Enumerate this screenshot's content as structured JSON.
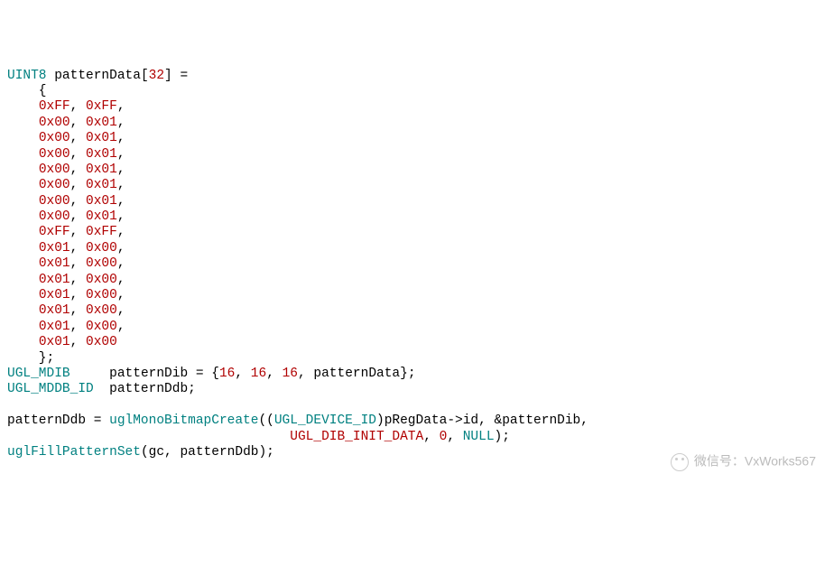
{
  "code": {
    "decl_type": "UINT8",
    "decl_name": "patternData",
    "decl_size_open": "[",
    "decl_size": "32",
    "decl_size_close": "] =",
    "brace_open": "    {",
    "rows": [
      {
        "a": "0xFF",
        "b": "0xFF"
      },
      {
        "a": "0x00",
        "b": "0x01"
      },
      {
        "a": "0x00",
        "b": "0x01"
      },
      {
        "a": "0x00",
        "b": "0x01"
      },
      {
        "a": "0x00",
        "b": "0x01"
      },
      {
        "a": "0x00",
        "b": "0x01"
      },
      {
        "a": "0x00",
        "b": "0x01"
      },
      {
        "a": "0x00",
        "b": "0x01"
      },
      {
        "a": "0xFF",
        "b": "0xFF"
      },
      {
        "a": "0x01",
        "b": "0x00"
      },
      {
        "a": "0x01",
        "b": "0x00"
      },
      {
        "a": "0x01",
        "b": "0x00"
      },
      {
        "a": "0x01",
        "b": "0x00"
      },
      {
        "a": "0x01",
        "b": "0x00"
      },
      {
        "a": "0x01",
        "b": "0x00"
      },
      {
        "a": "0x01",
        "b": "0x00"
      }
    ],
    "brace_close": "    };",
    "mdib_type": "UGL_MDIB",
    "mdib_name": "patternDib",
    "mdib_eq": " = {",
    "mdib_v1": "16",
    "mdib_v2": "16",
    "mdib_v3": "16",
    "mdib_v4": "patternData",
    "mdib_close": "};",
    "mddb_type": "UGL_MDDB_ID",
    "mddb_name": "patternDdb",
    "mddb_semi": ";",
    "assign_lhs": "patternDdb",
    "assign_eq": " = ",
    "fn_create": "uglMonoBitmapCreate",
    "cast_type": "UGL_DEVICE_ID",
    "cast_expr_obj": "pRegData",
    "cast_expr_arrow": "->",
    "cast_expr_field": "id",
    "arg_amp": "&",
    "arg_dib": "patternDib",
    "macro_init": "UGL_DIB_INIT_DATA",
    "arg_zero": "0",
    "arg_null": "NULL",
    "fn_fill": "uglFillPatternSet",
    "fill_arg1": "gc",
    "fill_arg2": "patternDdb"
  },
  "watermark": "微信号：VxWorks567"
}
